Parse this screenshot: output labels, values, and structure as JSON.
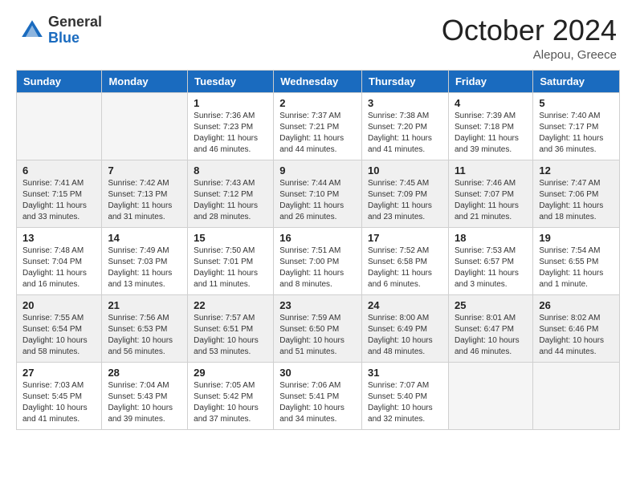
{
  "header": {
    "logo_general": "General",
    "logo_blue": "Blue",
    "month_title": "October 2024",
    "subtitle": "Alepou, Greece"
  },
  "days_of_week": [
    "Sunday",
    "Monday",
    "Tuesday",
    "Wednesday",
    "Thursday",
    "Friday",
    "Saturday"
  ],
  "weeks": [
    [
      {
        "day": "",
        "empty": true
      },
      {
        "day": "",
        "empty": true
      },
      {
        "day": "1",
        "sunrise": "Sunrise: 7:36 AM",
        "sunset": "Sunset: 7:23 PM",
        "daylight": "Daylight: 11 hours and 46 minutes."
      },
      {
        "day": "2",
        "sunrise": "Sunrise: 7:37 AM",
        "sunset": "Sunset: 7:21 PM",
        "daylight": "Daylight: 11 hours and 44 minutes."
      },
      {
        "day": "3",
        "sunrise": "Sunrise: 7:38 AM",
        "sunset": "Sunset: 7:20 PM",
        "daylight": "Daylight: 11 hours and 41 minutes."
      },
      {
        "day": "4",
        "sunrise": "Sunrise: 7:39 AM",
        "sunset": "Sunset: 7:18 PM",
        "daylight": "Daylight: 11 hours and 39 minutes."
      },
      {
        "day": "5",
        "sunrise": "Sunrise: 7:40 AM",
        "sunset": "Sunset: 7:17 PM",
        "daylight": "Daylight: 11 hours and 36 minutes."
      }
    ],
    [
      {
        "day": "6",
        "sunrise": "Sunrise: 7:41 AM",
        "sunset": "Sunset: 7:15 PM",
        "daylight": "Daylight: 11 hours and 33 minutes."
      },
      {
        "day": "7",
        "sunrise": "Sunrise: 7:42 AM",
        "sunset": "Sunset: 7:13 PM",
        "daylight": "Daylight: 11 hours and 31 minutes."
      },
      {
        "day": "8",
        "sunrise": "Sunrise: 7:43 AM",
        "sunset": "Sunset: 7:12 PM",
        "daylight": "Daylight: 11 hours and 28 minutes."
      },
      {
        "day": "9",
        "sunrise": "Sunrise: 7:44 AM",
        "sunset": "Sunset: 7:10 PM",
        "daylight": "Daylight: 11 hours and 26 minutes."
      },
      {
        "day": "10",
        "sunrise": "Sunrise: 7:45 AM",
        "sunset": "Sunset: 7:09 PM",
        "daylight": "Daylight: 11 hours and 23 minutes."
      },
      {
        "day": "11",
        "sunrise": "Sunrise: 7:46 AM",
        "sunset": "Sunset: 7:07 PM",
        "daylight": "Daylight: 11 hours and 21 minutes."
      },
      {
        "day": "12",
        "sunrise": "Sunrise: 7:47 AM",
        "sunset": "Sunset: 7:06 PM",
        "daylight": "Daylight: 11 hours and 18 minutes."
      }
    ],
    [
      {
        "day": "13",
        "sunrise": "Sunrise: 7:48 AM",
        "sunset": "Sunset: 7:04 PM",
        "daylight": "Daylight: 11 hours and 16 minutes."
      },
      {
        "day": "14",
        "sunrise": "Sunrise: 7:49 AM",
        "sunset": "Sunset: 7:03 PM",
        "daylight": "Daylight: 11 hours and 13 minutes."
      },
      {
        "day": "15",
        "sunrise": "Sunrise: 7:50 AM",
        "sunset": "Sunset: 7:01 PM",
        "daylight": "Daylight: 11 hours and 11 minutes."
      },
      {
        "day": "16",
        "sunrise": "Sunrise: 7:51 AM",
        "sunset": "Sunset: 7:00 PM",
        "daylight": "Daylight: 11 hours and 8 minutes."
      },
      {
        "day": "17",
        "sunrise": "Sunrise: 7:52 AM",
        "sunset": "Sunset: 6:58 PM",
        "daylight": "Daylight: 11 hours and 6 minutes."
      },
      {
        "day": "18",
        "sunrise": "Sunrise: 7:53 AM",
        "sunset": "Sunset: 6:57 PM",
        "daylight": "Daylight: 11 hours and 3 minutes."
      },
      {
        "day": "19",
        "sunrise": "Sunrise: 7:54 AM",
        "sunset": "Sunset: 6:55 PM",
        "daylight": "Daylight: 11 hours and 1 minute."
      }
    ],
    [
      {
        "day": "20",
        "sunrise": "Sunrise: 7:55 AM",
        "sunset": "Sunset: 6:54 PM",
        "daylight": "Daylight: 10 hours and 58 minutes."
      },
      {
        "day": "21",
        "sunrise": "Sunrise: 7:56 AM",
        "sunset": "Sunset: 6:53 PM",
        "daylight": "Daylight: 10 hours and 56 minutes."
      },
      {
        "day": "22",
        "sunrise": "Sunrise: 7:57 AM",
        "sunset": "Sunset: 6:51 PM",
        "daylight": "Daylight: 10 hours and 53 minutes."
      },
      {
        "day": "23",
        "sunrise": "Sunrise: 7:59 AM",
        "sunset": "Sunset: 6:50 PM",
        "daylight": "Daylight: 10 hours and 51 minutes."
      },
      {
        "day": "24",
        "sunrise": "Sunrise: 8:00 AM",
        "sunset": "Sunset: 6:49 PM",
        "daylight": "Daylight: 10 hours and 48 minutes."
      },
      {
        "day": "25",
        "sunrise": "Sunrise: 8:01 AM",
        "sunset": "Sunset: 6:47 PM",
        "daylight": "Daylight: 10 hours and 46 minutes."
      },
      {
        "day": "26",
        "sunrise": "Sunrise: 8:02 AM",
        "sunset": "Sunset: 6:46 PM",
        "daylight": "Daylight: 10 hours and 44 minutes."
      }
    ],
    [
      {
        "day": "27",
        "sunrise": "Sunrise: 7:03 AM",
        "sunset": "Sunset: 5:45 PM",
        "daylight": "Daylight: 10 hours and 41 minutes."
      },
      {
        "day": "28",
        "sunrise": "Sunrise: 7:04 AM",
        "sunset": "Sunset: 5:43 PM",
        "daylight": "Daylight: 10 hours and 39 minutes."
      },
      {
        "day": "29",
        "sunrise": "Sunrise: 7:05 AM",
        "sunset": "Sunset: 5:42 PM",
        "daylight": "Daylight: 10 hours and 37 minutes."
      },
      {
        "day": "30",
        "sunrise": "Sunrise: 7:06 AM",
        "sunset": "Sunset: 5:41 PM",
        "daylight": "Daylight: 10 hours and 34 minutes."
      },
      {
        "day": "31",
        "sunrise": "Sunrise: 7:07 AM",
        "sunset": "Sunset: 5:40 PM",
        "daylight": "Daylight: 10 hours and 32 minutes."
      },
      {
        "day": "",
        "empty": true
      },
      {
        "day": "",
        "empty": true
      }
    ]
  ]
}
